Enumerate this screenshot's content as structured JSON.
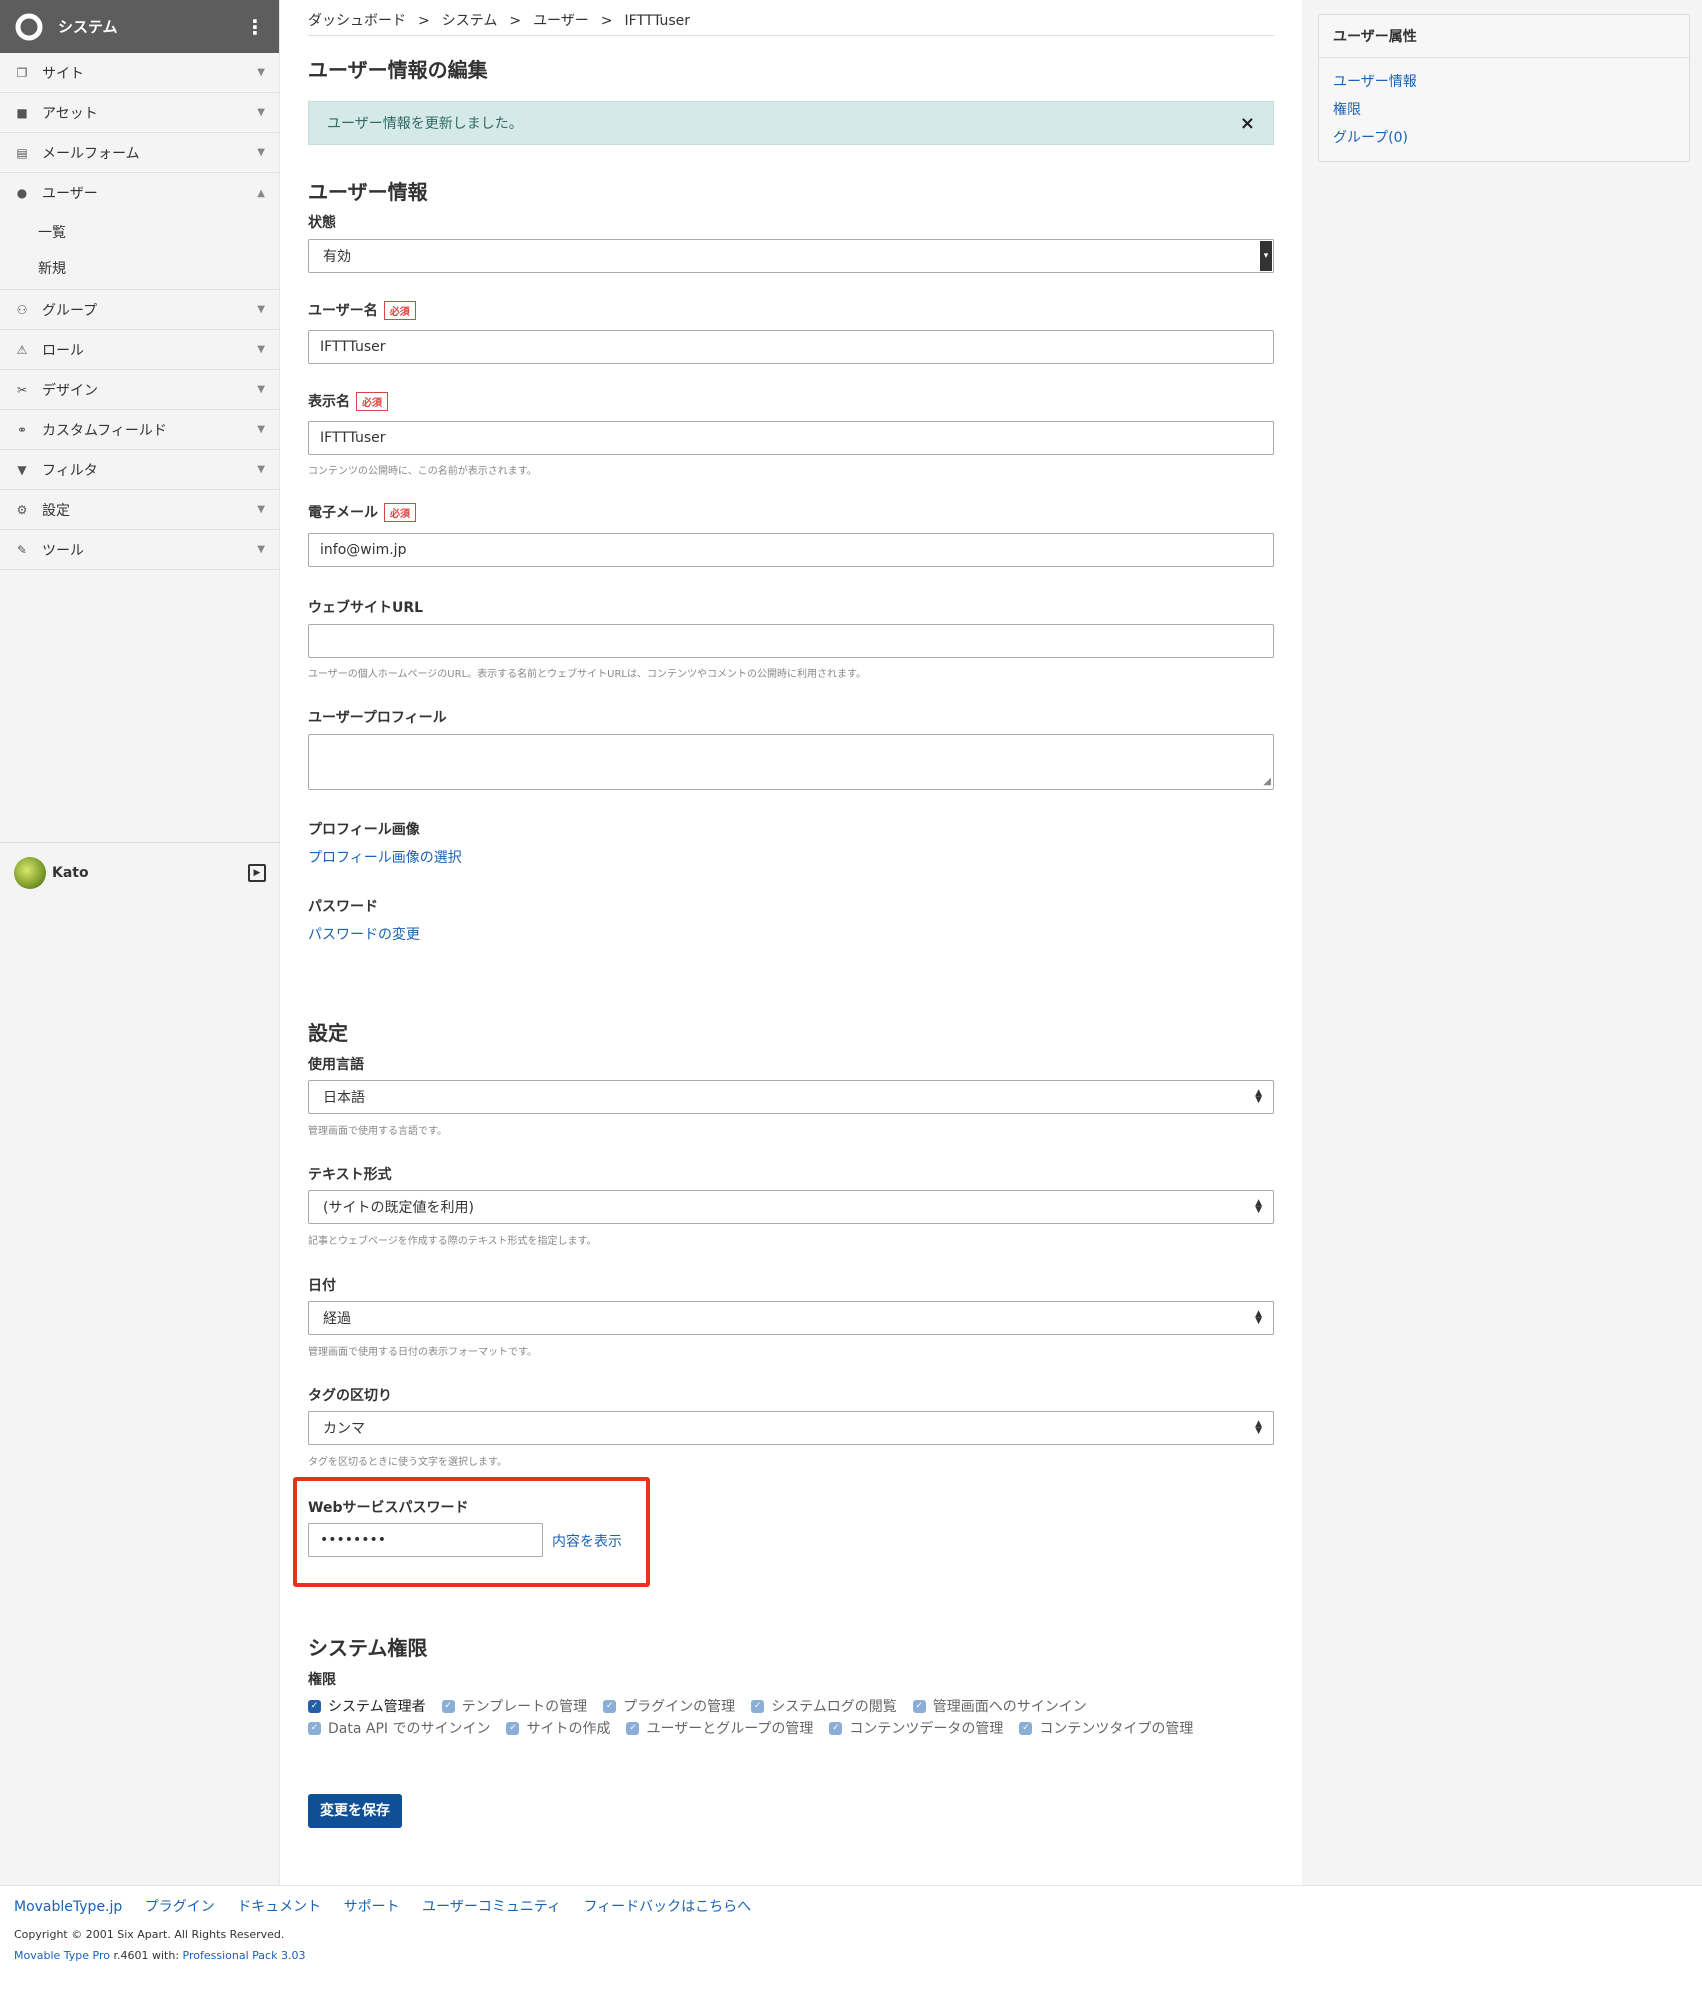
{
  "sidebar": {
    "title": "システム",
    "items": [
      {
        "label": "サイト",
        "icon": "site-icon"
      },
      {
        "label": "アセット",
        "icon": "asset-icon"
      },
      {
        "label": "メールフォーム",
        "icon": "mailform-icon"
      },
      {
        "label": "ユーザー",
        "icon": "user-icon"
      },
      {
        "label": "グループ",
        "icon": "group-icon"
      },
      {
        "label": "ロール",
        "icon": "role-icon"
      },
      {
        "label": "デザイン",
        "icon": "design-icon"
      },
      {
        "label": "カスタムフィールド",
        "icon": "customfield-icon"
      },
      {
        "label": "フィルタ",
        "icon": "filter-icon"
      },
      {
        "label": "設定",
        "icon": "gear-icon"
      },
      {
        "label": "ツール",
        "icon": "wrench-icon"
      }
    ],
    "user_subitems": [
      "一覧",
      "新規"
    ],
    "current_user": "Kato"
  },
  "breadcrumb": [
    "ダッシュボード",
    "システム",
    "ユーザー",
    "IFTTTuser"
  ],
  "breadcrumb_sep": ">",
  "page_title": "ユーザー情報の編集",
  "alert": {
    "message": "ユーザー情報を更新しました。",
    "close": "×"
  },
  "user_info": {
    "heading": "ユーザー情報",
    "status_label": "状態",
    "status_value": "有効",
    "required_badge": "必須",
    "username_label": "ユーザー名",
    "username_value": "IFTTTuser",
    "display_name_label": "表示名",
    "display_name_value": "IFTTTuser",
    "display_name_hint": "コンテンツの公開時に、この名前が表示されます。",
    "email_label": "電子メール",
    "email_value": "info@wim.jp",
    "website_label": "ウェブサイトURL",
    "website_value": "",
    "website_hint": "ユーザーの個人ホームページのURL。表示する名前とウェブサイトURLは、コンテンツやコメントの公開時に利用されます。",
    "profile_label": "ユーザープロフィール",
    "profile_value": "",
    "image_label": "プロフィール画像",
    "image_link": "プロフィール画像の選択",
    "password_label": "パスワード",
    "password_link": "パスワードの変更"
  },
  "settings": {
    "heading": "設定",
    "language_label": "使用言語",
    "language_value": "日本語",
    "language_hint": "管理画面で使用する言語です。",
    "text_format_label": "テキスト形式",
    "text_format_value": "(サイトの既定値を利用)",
    "text_format_hint": "記事とウェブページを作成する際のテキスト形式を指定します。",
    "date_label": "日付",
    "date_value": "経過",
    "date_hint": "管理画面で使用する日付の表示フォーマットです。",
    "tag_label": "タグの区切り",
    "tag_value": "カンマ",
    "tag_hint": "タグを区切るときに使う文字を選択します。",
    "ws_password_label": "Webサービスパスワード",
    "ws_password_value": "••••••••",
    "ws_password_show": "内容を表示"
  },
  "permissions": {
    "heading": "システム権限",
    "label": "権限",
    "row1": [
      {
        "label": "システム管理者",
        "checked": true
      },
      {
        "label": "テンプレートの管理",
        "checked": true
      },
      {
        "label": "プラグインの管理",
        "checked": true
      },
      {
        "label": "システムログの閲覧",
        "checked": true
      },
      {
        "label": "管理画面へのサインイン",
        "checked": true
      }
    ],
    "row2": [
      {
        "label": "Data API でのサインイン",
        "checked": true
      },
      {
        "label": "サイトの作成",
        "checked": true
      },
      {
        "label": "ユーザーとグループの管理",
        "checked": true
      },
      {
        "label": "コンテンツデータの管理",
        "checked": true
      },
      {
        "label": "コンテンツタイプの管理",
        "checked": true
      }
    ]
  },
  "save_button": "変更を保存",
  "right_panel": {
    "title": "ユーザー属性",
    "links": [
      "ユーザー情報",
      "権限",
      "グループ(0)"
    ]
  },
  "footer": {
    "links": [
      "MovableType.jp",
      "プラグイン",
      "ドキュメント",
      "サポート",
      "ユーザーコミュニティ",
      "フィードバックはこちらへ"
    ],
    "copyright": "Copyright © 2001 Six Apart. All Rights Reserved.",
    "version_product": "Movable Type Pro",
    "version_text": " r.4601 with: ",
    "version_pack": "Professional Pack 3.03"
  },
  "colors": {
    "accent": "#1a62b4",
    "highlight_border": "#e8321e",
    "alert_bg": "#d5e9e8",
    "save_button": "#0f4f96"
  }
}
